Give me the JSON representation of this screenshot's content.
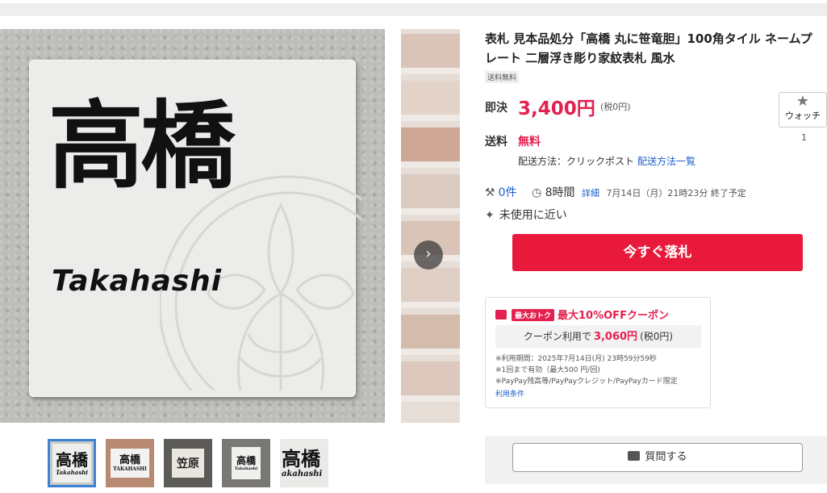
{
  "gallery": {
    "main_kanji": "高橋",
    "main_romaji": "Takahashi",
    "next_label": "›",
    "thumbs": [
      {
        "line1": "高橋",
        "line2": "Takahashi"
      },
      {
        "line1": "高橋",
        "line2": "TAKAHASHI"
      },
      {
        "line1": "笠原",
        "line2": ""
      },
      {
        "line1": "高橋",
        "line2": "Takahashi"
      },
      {
        "line1": "高橋",
        "line2": "akahashi"
      }
    ]
  },
  "item": {
    "title": "表札 見本品処分「高橋 丸に笹竜胆」100角タイル ネームプレート 二層浮き彫り家紋表札 風水",
    "tag": "送料無料",
    "price_label": "即決",
    "price": "3,400円",
    "price_tax": "(税0円)",
    "watch_label": "ウォッチ",
    "watch_count": "1",
    "shipping_label": "送料",
    "shipping_value": "無料",
    "shipping_method": "配送方法：クリックポスト",
    "shipping_link": "配送方法一覧",
    "bids": "0件",
    "time_left": "8時間",
    "detail_link": "詳細",
    "end_time": "7月14日（月）21時23分 終了予定",
    "condition": "未使用に近い",
    "bid_button": "今すぐ落札"
  },
  "coupon": {
    "badge": "最大おトク",
    "title": "最大10%OFFクーポン",
    "use_prefix": "クーポン利用で",
    "use_amount": "3,060円",
    "use_tax": "(税0円)",
    "note1": "※利用期間：2025年7月14日(月) 23時59分59秒",
    "note2": "※1回まで有効（最大500 円/回)",
    "note3": "※PayPay残高等/PayPayクレジット/PayPayカード限定",
    "terms_link": "利用条件"
  },
  "question_button": "質問する",
  "colors": {
    "accent": "#e32150",
    "link": "#1a5fc9",
    "bid_button": "#e8193b"
  }
}
